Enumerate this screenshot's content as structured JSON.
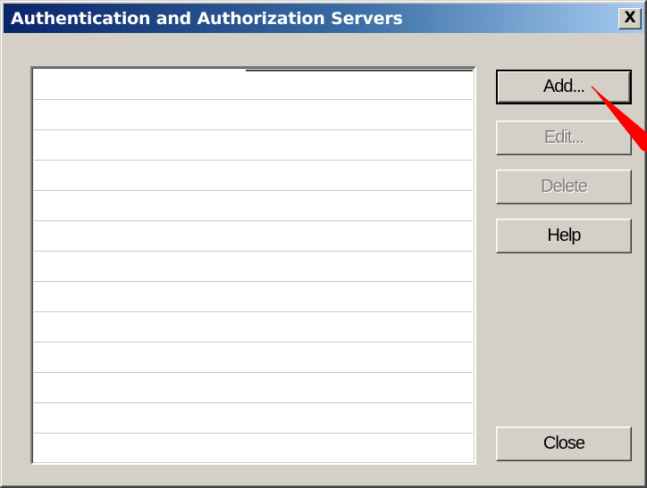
{
  "window": {
    "title": "Authentication and Authorization Servers",
    "close_glyph": "X"
  },
  "servers_list": {
    "rows": [
      "",
      "",
      "",
      "",
      "",
      "",
      "",
      "",
      "",
      "",
      "",
      "",
      ""
    ]
  },
  "buttons": {
    "add": "Add...",
    "edit": "Edit...",
    "delete": "Delete",
    "help": "Help",
    "close": "Close"
  },
  "annotation": {
    "icon": "red-arrow-icon",
    "color": "#ff0000"
  },
  "colors": {
    "titlebar_start": "#0a246a",
    "titlebar_end": "#a6caf0",
    "dialog_face": "#d4d0c8",
    "disabled_text": "#808080"
  }
}
